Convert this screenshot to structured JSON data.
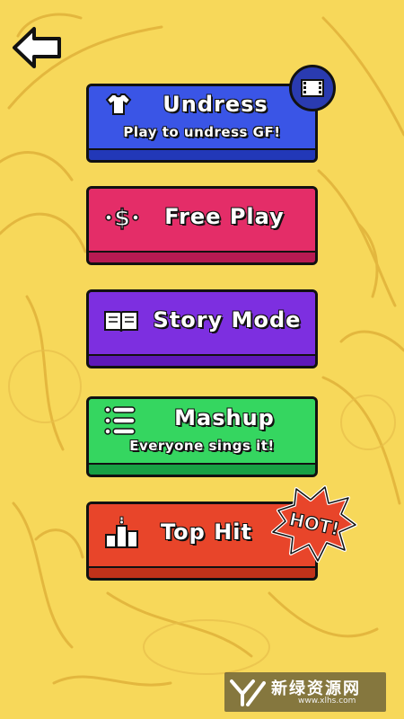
{
  "back_button": {
    "icon": "back-arrow-icon"
  },
  "menu": {
    "undress": {
      "title": "Undress",
      "subtitle": "Play to undress GF!",
      "icon": "shirt-icon",
      "badge_icon": "film-icon"
    },
    "free_play": {
      "title": "Free Play",
      "icon": "dollar-icon"
    },
    "story_mode": {
      "title": "Story Mode",
      "icon": "book-icon"
    },
    "mashup": {
      "title": "Mashup",
      "subtitle": "Everyone sings it!",
      "icon": "list-icon"
    },
    "top_hit": {
      "title": "Top Hit",
      "icon": "podium-icon",
      "badge": "HOT!"
    }
  },
  "watermark": {
    "text": "新绿资源网",
    "url": "www.xlhs.com"
  },
  "colors": {
    "background": "#f7d85a",
    "undress": "#3a55e6",
    "free_play": "#e42d68",
    "story_mode": "#7d2fe0",
    "mashup": "#35d660",
    "top_hit": "#e8452a"
  }
}
